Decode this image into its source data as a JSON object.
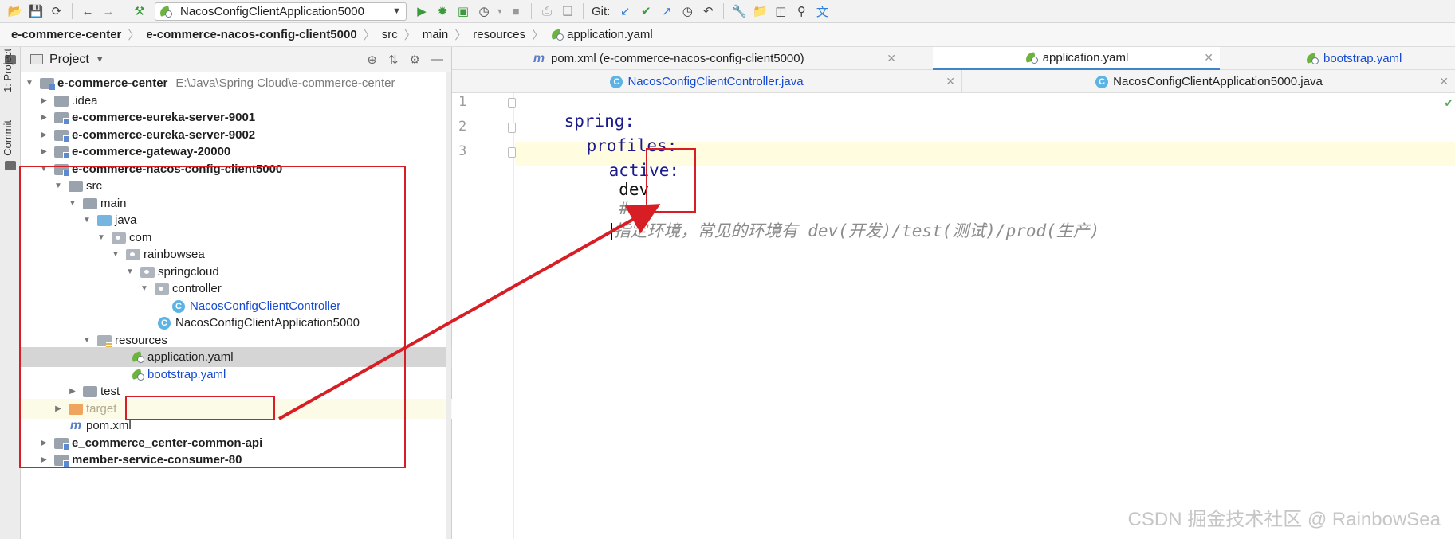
{
  "toolbar": {
    "run_config": "NacosConfigClientApplication5000",
    "git_label": "Git:"
  },
  "breadcrumb": [
    "e-commerce-center",
    "e-commerce-nacos-config-client5000",
    "src",
    "main",
    "resources",
    "application.yaml"
  ],
  "left_strip": {
    "project_tab": "1: Project",
    "commit_tab": "Commit"
  },
  "project_panel": {
    "title": "Project",
    "tree": [
      {
        "label": "e-commerce-center",
        "hint": "E:\\Java\\Spring Cloud\\e-commerce-center"
      },
      {
        "label": ".idea"
      },
      {
        "label": "e-commerce-eureka-server-9001"
      },
      {
        "label": "e-commerce-eureka-server-9002"
      },
      {
        "label": "e-commerce-gateway-20000"
      },
      {
        "label": "e-commerce-nacos-config-client5000"
      },
      {
        "label": "src"
      },
      {
        "label": "main"
      },
      {
        "label": "java"
      },
      {
        "label": "com"
      },
      {
        "label": "rainbowsea"
      },
      {
        "label": "springcloud"
      },
      {
        "label": "controller"
      },
      {
        "label": "NacosConfigClientController"
      },
      {
        "label": "NacosConfigClientApplication5000"
      },
      {
        "label": "resources"
      },
      {
        "label": "application.yaml"
      },
      {
        "label": "bootstrap.yaml"
      },
      {
        "label": "test"
      },
      {
        "label": "target"
      },
      {
        "label": "pom.xml"
      },
      {
        "label": "e_commerce_center-common-api"
      },
      {
        "label": "member-service-consumer-80"
      }
    ]
  },
  "editor": {
    "tabs_row1": [
      {
        "label": "pom.xml (e-commerce-nacos-config-client5000)"
      },
      {
        "label": "application.yaml"
      },
      {
        "label": "bootstrap.yaml"
      }
    ],
    "tabs_row2": [
      {
        "label": "NacosConfigClientController.java"
      },
      {
        "label": "NacosConfigClientApplication5000.java"
      }
    ],
    "lines": [
      {
        "num": "1",
        "key": "spring:"
      },
      {
        "num": "2",
        "key": "profiles:"
      },
      {
        "num": "3",
        "key": "active:",
        "value": "dev",
        "comment_hash": "#",
        "comment": "指定环境，常见的环境有 dev(开发)/test(测试)/prod(生产)"
      }
    ]
  },
  "watermark": "CSDN 掘金技术社区 @ RainbowSea",
  "colors": {
    "annotation_red": "#d81e25",
    "selected_row": "#d5d5d5",
    "active_tab_underline": "#4083c9"
  }
}
